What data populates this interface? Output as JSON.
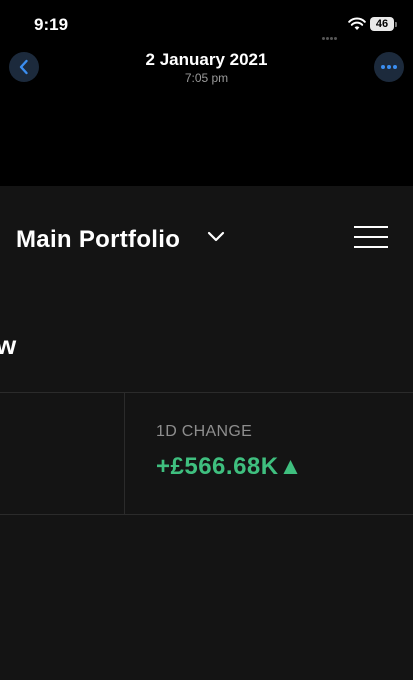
{
  "status_bar": {
    "time": "9:19",
    "battery": "46"
  },
  "header": {
    "date": "2 January 2021",
    "time": "7:05 pm"
  },
  "app": {
    "portfolio_title": "Main Portfolio",
    "section_partial": "w",
    "change_label": "1D CHANGE",
    "change_value": "+£566.68K▲"
  },
  "colors": {
    "positive": "#3fbf7f",
    "accent": "#3b8ef0",
    "surface": "#141414"
  },
  "icons": [
    "back-chevron-icon",
    "more-icon",
    "chevron-down-icon",
    "hamburger-menu-icon",
    "wifi-icon"
  ]
}
